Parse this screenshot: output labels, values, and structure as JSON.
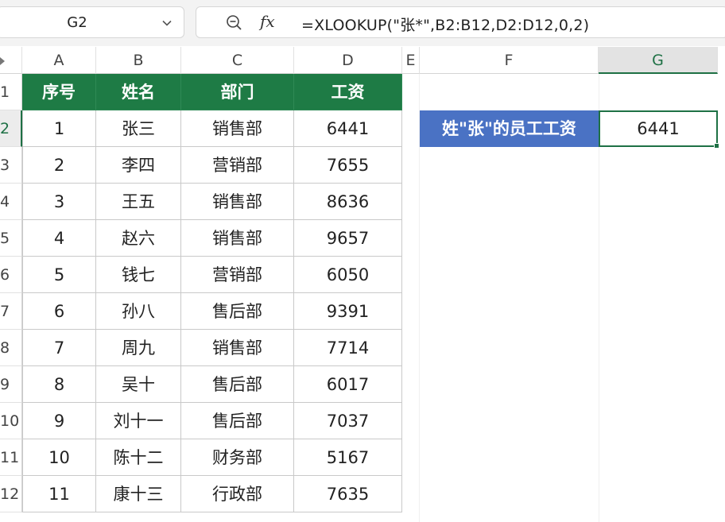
{
  "name_box": {
    "value": "G2"
  },
  "formula_bar": {
    "fx_label": "fx",
    "formula": "=XLOOKUP(\"张*\",B2:B12,D2:D12,0,2)"
  },
  "columns": [
    "A",
    "B",
    "C",
    "D",
    "E",
    "F",
    "G"
  ],
  "rows": [
    "1",
    "2",
    "3",
    "4",
    "5",
    "6",
    "7",
    "8",
    "9",
    "10",
    "11",
    "12"
  ],
  "table": {
    "headers": [
      "序号",
      "姓名",
      "部门",
      "工资"
    ],
    "rows": [
      [
        "1",
        "张三",
        "销售部",
        "6441"
      ],
      [
        "2",
        "李四",
        "营销部",
        "7655"
      ],
      [
        "3",
        "王五",
        "销售部",
        "8636"
      ],
      [
        "4",
        "赵六",
        "销售部",
        "9657"
      ],
      [
        "5",
        "钱七",
        "营销部",
        "6050"
      ],
      [
        "6",
        "孙八",
        "售后部",
        "9391"
      ],
      [
        "7",
        "周九",
        "销售部",
        "7714"
      ],
      [
        "8",
        "吴十",
        "售后部",
        "6017"
      ],
      [
        "9",
        "刘十一",
        "售后部",
        "7037"
      ],
      [
        "10",
        "陈十二",
        "财务部",
        "5167"
      ],
      [
        "11",
        "康十三",
        "行政部",
        "7635"
      ]
    ]
  },
  "lookup": {
    "label": "姓\"张\"的员工工资",
    "result": "6441"
  },
  "colors": {
    "header_green": "#1e7b45",
    "label_blue": "#4a72c4",
    "selection_green": "#1e7145"
  }
}
